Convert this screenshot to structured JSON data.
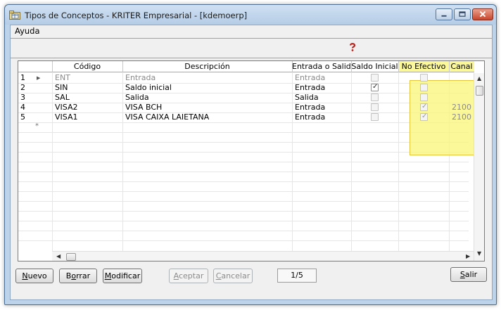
{
  "window": {
    "title": "Tipos de Conceptos - KRITER Empresarial - [kdemoerp]"
  },
  "menu": {
    "items": [
      "Ayuda"
    ]
  },
  "grid": {
    "columns": [
      "",
      "Código",
      "Descripción",
      "Entrada o Salida",
      "Saldo Inicial",
      "No Efectivo",
      "Canal"
    ],
    "rows": [
      {
        "num": "1",
        "codigo": "ENT",
        "descripcion": "Entrada",
        "entrada_salida": "Entrada",
        "saldo_inicial": false,
        "no_efectivo": false,
        "canal": "",
        "current": true
      },
      {
        "num": "2",
        "codigo": "SIN",
        "descripcion": "Saldo inicial",
        "entrada_salida": "Entrada",
        "saldo_inicial": true,
        "no_efectivo": false,
        "canal": ""
      },
      {
        "num": "3",
        "codigo": "SAL",
        "descripcion": "Salida",
        "entrada_salida": "Salida",
        "saldo_inicial": false,
        "no_efectivo": false,
        "canal": ""
      },
      {
        "num": "4",
        "codigo": "VISA2",
        "descripcion": "VISA BCH",
        "entrada_salida": "Entrada",
        "saldo_inicial": false,
        "no_efectivo": true,
        "canal": "2100"
      },
      {
        "num": "5",
        "codigo": "VISA1",
        "descripcion": "VISA CAIXA LAIETANA",
        "entrada_salida": "Entrada",
        "saldo_inicial": false,
        "no_efectivo": true,
        "canal": "2100"
      }
    ],
    "new_row_marker": "*"
  },
  "buttons": {
    "nuevo": {
      "accel": "N",
      "rest": "uevo"
    },
    "borrar": {
      "pre": "B",
      "accel": "o",
      "rest": "rrar"
    },
    "modificar": {
      "accel": "M",
      "rest": "odificar"
    },
    "aceptar": {
      "accel": "A",
      "rest": "ceptar"
    },
    "cancelar": {
      "accel": "C",
      "rest": "ancelar"
    },
    "salir": {
      "accel": "S",
      "rest": "alir"
    }
  },
  "record_counter": "1/5",
  "colors": {
    "highlight": "#faf678",
    "title_bar": "#bcd3ea",
    "close_button": "#c8462b"
  }
}
